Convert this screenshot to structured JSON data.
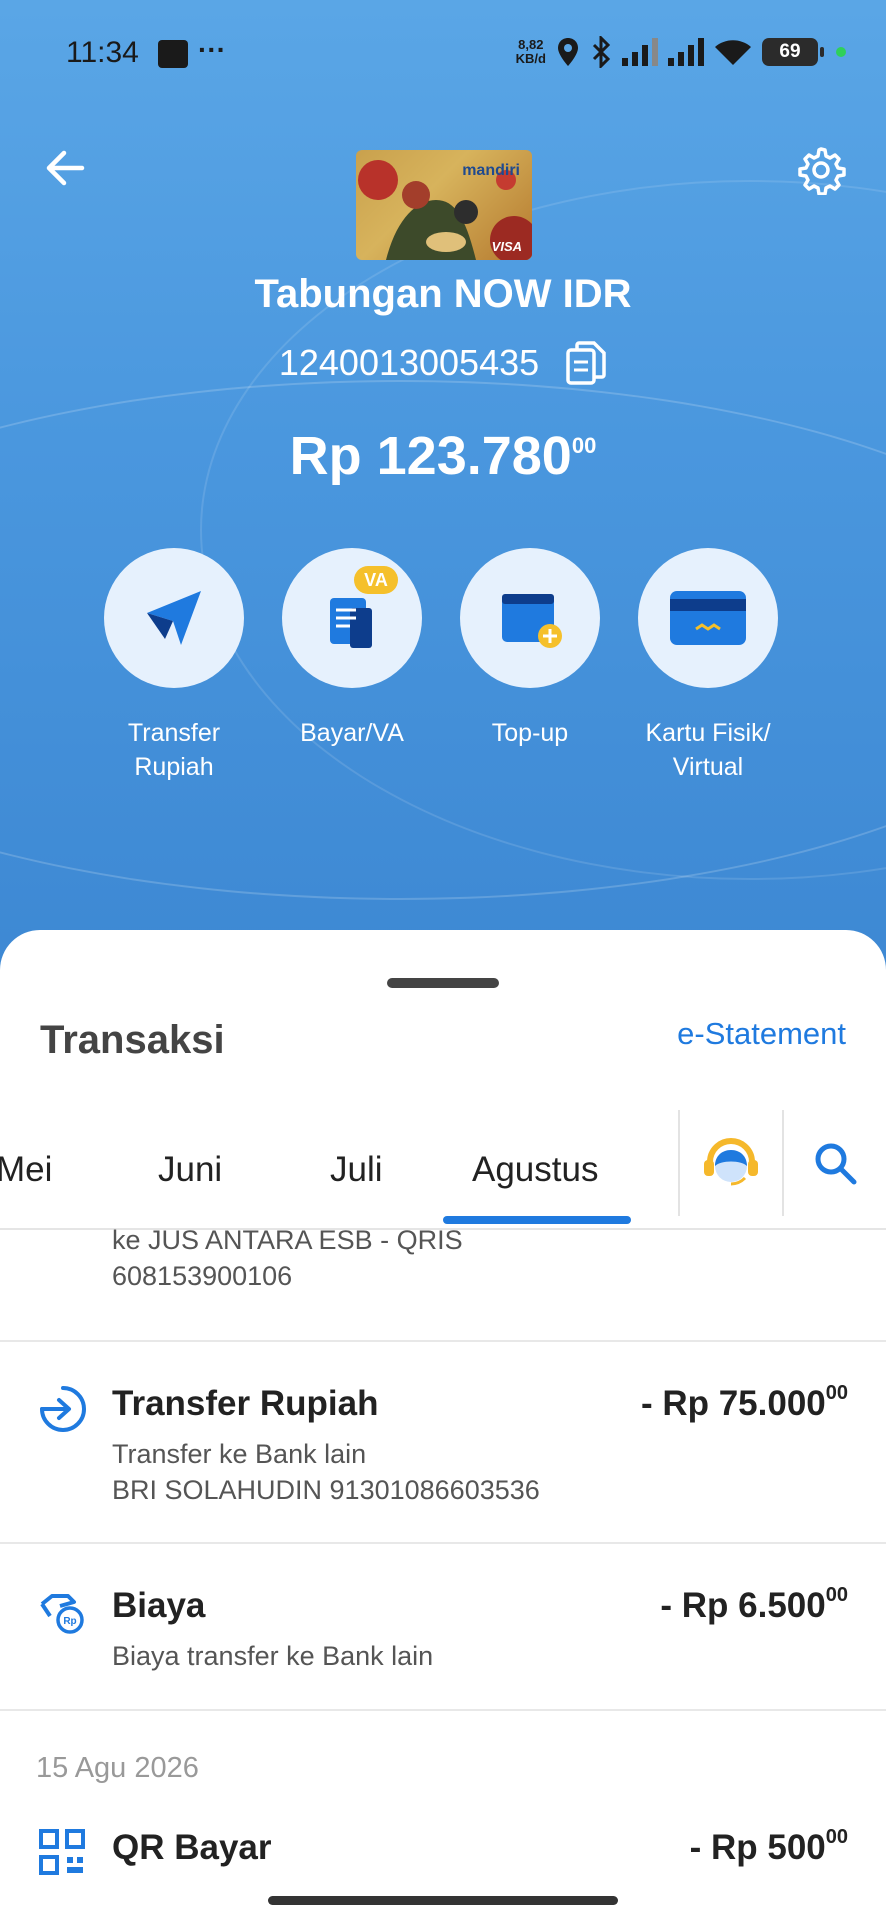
{
  "status_bar": {
    "time": "11:34",
    "ellipsis": "···",
    "net_speed_value": "8,82",
    "net_speed_unit": "KB/d",
    "battery": "69"
  },
  "header": {
    "card_brand": "mandiri",
    "card_network": "VISA",
    "account_name": "Tabungan NOW IDR",
    "account_number": "1240013005435",
    "balance_main": "Rp 123.780",
    "balance_cents": "00"
  },
  "actions": [
    {
      "label": "Transfer\nRupiah"
    },
    {
      "label": "Bayar/VA",
      "badge": "VA"
    },
    {
      "label": "Top-up"
    },
    {
      "label": "Kartu Fisik/\nVirtual"
    }
  ],
  "sheet": {
    "title": "Transaksi",
    "link": "e-Statement",
    "tabs": [
      "Mei",
      "Juni",
      "Juli",
      "Agustus"
    ],
    "active_tab": "Agustus"
  },
  "transactions": {
    "partial": {
      "line1": "ke JUS ANTARA ESB - QRIS",
      "line2": "608153900106"
    },
    "items": [
      {
        "title": "Transfer Rupiah",
        "amount": "- Rp 75.000",
        "cents": "00",
        "desc1": "Transfer ke Bank lain",
        "desc2": "BRI SOLAHUDIN 91301086603536",
        "icon": "transfer-in-circle-icon"
      },
      {
        "title": "Biaya",
        "amount": "- Rp 6.500",
        "cents": "00",
        "desc1": "Biaya transfer ke Bank lain",
        "icon": "fee-hand-icon"
      }
    ],
    "date_header": "15 Agu 2026",
    "last": {
      "title": "QR Bayar",
      "amount": "- Rp 500",
      "cents": "00",
      "icon": "qr-code-icon"
    }
  },
  "colors": {
    "accent": "#1f7adf",
    "header_blue": "#4a97de",
    "icon_circle": "#e6f1fd"
  }
}
